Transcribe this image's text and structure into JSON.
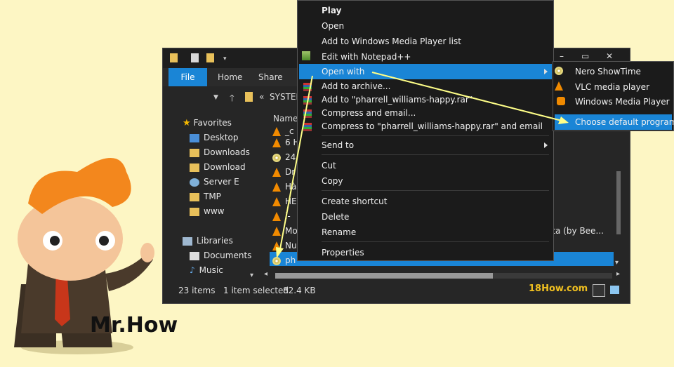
{
  "window": {
    "title_controls": [
      "–",
      "▭",
      "✕"
    ],
    "ribbon_tabs": [
      "File",
      "Home",
      "Share"
    ],
    "address": "SYSTEM",
    "column_header": "Name",
    "nav": {
      "favorites_label": "Favorites",
      "favorites": [
        "Desktop",
        "Downloads",
        "Download",
        "Server E",
        "TMP",
        "www"
      ],
      "libraries_label": "Libraries",
      "libraries": [
        "Documents",
        "Music"
      ]
    },
    "files": [
      "_c",
      "6 H",
      "24",
      "Dr",
      "Hà",
      "HE",
      "i-",
      "Mo",
      "Nu",
      "ph"
    ],
    "truncated_detail": "ata (by Bee...",
    "status": {
      "items": "23 items",
      "selected": "1 item selected",
      "size": "82.4 KB"
    }
  },
  "context_menu": {
    "items": {
      "play": "Play",
      "open": "Open",
      "add_wmp": "Add to Windows Media Player list",
      "edit_notepad": "Edit with Notepad++",
      "open_with": "Open with",
      "add_archive": "Add to archive...",
      "add_rar": "Add to \"pharrell_williams-happy.rar\"",
      "compress_email": "Compress and email...",
      "compress_rar_email": "Compress to \"pharrell_williams-happy.rar\" and email",
      "send_to": "Send to",
      "cut": "Cut",
      "copy": "Copy",
      "create_shortcut": "Create shortcut",
      "delete": "Delete",
      "rename": "Rename",
      "properties": "Properties"
    }
  },
  "submenu": {
    "items": [
      "Nero ShowTime",
      "VLC media player",
      "Windows Media Player",
      "Choose default program..."
    ]
  },
  "branding": {
    "site": "18How.com",
    "mascot_text": "Mr.How"
  },
  "colors": {
    "accent": "#1a85d6",
    "menu_bg": "#1b1b1b",
    "background": "#fdf6c4",
    "arrow": "#ffff88"
  }
}
